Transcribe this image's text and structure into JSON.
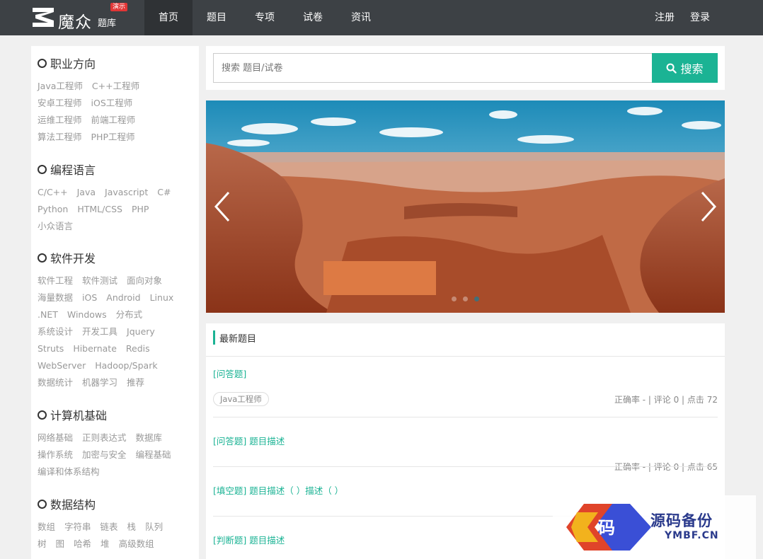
{
  "header": {
    "logo_text": "魔众",
    "logo_sub": "题库",
    "logo_badge": "演示",
    "nav": [
      "首页",
      "题目",
      "专项",
      "试卷",
      "资讯"
    ],
    "auth": [
      "注册",
      "登录"
    ]
  },
  "sidebar": {
    "categories": [
      {
        "title": "职业方向",
        "links": [
          "Java工程师",
          "C++工程师",
          "安卓工程师",
          "iOS工程师",
          "运维工程师",
          "前端工程师",
          "算法工程师",
          "PHP工程师"
        ]
      },
      {
        "title": "编程语言",
        "links": [
          "C/C++",
          "Java",
          "Javascript",
          "C#",
          "Python",
          "HTML/CSS",
          "PHP",
          "小众语言"
        ]
      },
      {
        "title": "软件开发",
        "links": [
          "软件工程",
          "软件测试",
          "面向对象",
          "海量数据",
          "iOS",
          "Android",
          "Linux",
          ".NET",
          "Windows",
          "分布式",
          "系统设计",
          "开发工具",
          "Jquery",
          "Struts",
          "Hibernate",
          "Redis",
          "WebServer",
          "Hadoop/Spark",
          "数据统计",
          "机器学习",
          "推荐"
        ]
      },
      {
        "title": "计算机基础",
        "links": [
          "网络基础",
          "正则表达式",
          "数据库",
          "操作系统",
          "加密与安全",
          "编程基础",
          "编译和体系结构"
        ]
      },
      {
        "title": "数据结构",
        "links": [
          "数组",
          "字符串",
          "链表",
          "栈",
          "队列",
          "树",
          "图",
          "哈希",
          "堆",
          "高级数组"
        ]
      }
    ]
  },
  "search": {
    "placeholder": "搜索 题目/试卷",
    "button": "搜索"
  },
  "latest": {
    "title": "最新题目",
    "items": [
      {
        "title": "[问答题]",
        "tag": "Java工程师",
        "meta": "正确率 - | 评论 0 | 点击 72"
      },
      {
        "title": "[问答题] 题目描述",
        "meta": "正确率 - | 评论 0 | 点击 65"
      },
      {
        "title": "[填空题] 题目描述（ ）描述（ ）"
      },
      {
        "title": "[判断题] 题目描述"
      }
    ]
  },
  "watermark": {
    "text": "源码备份",
    "sub": "YMBF.CN",
    "glyph": "码"
  },
  "colors": {
    "accent": "#1bb394",
    "topbar": "#3d4145"
  }
}
